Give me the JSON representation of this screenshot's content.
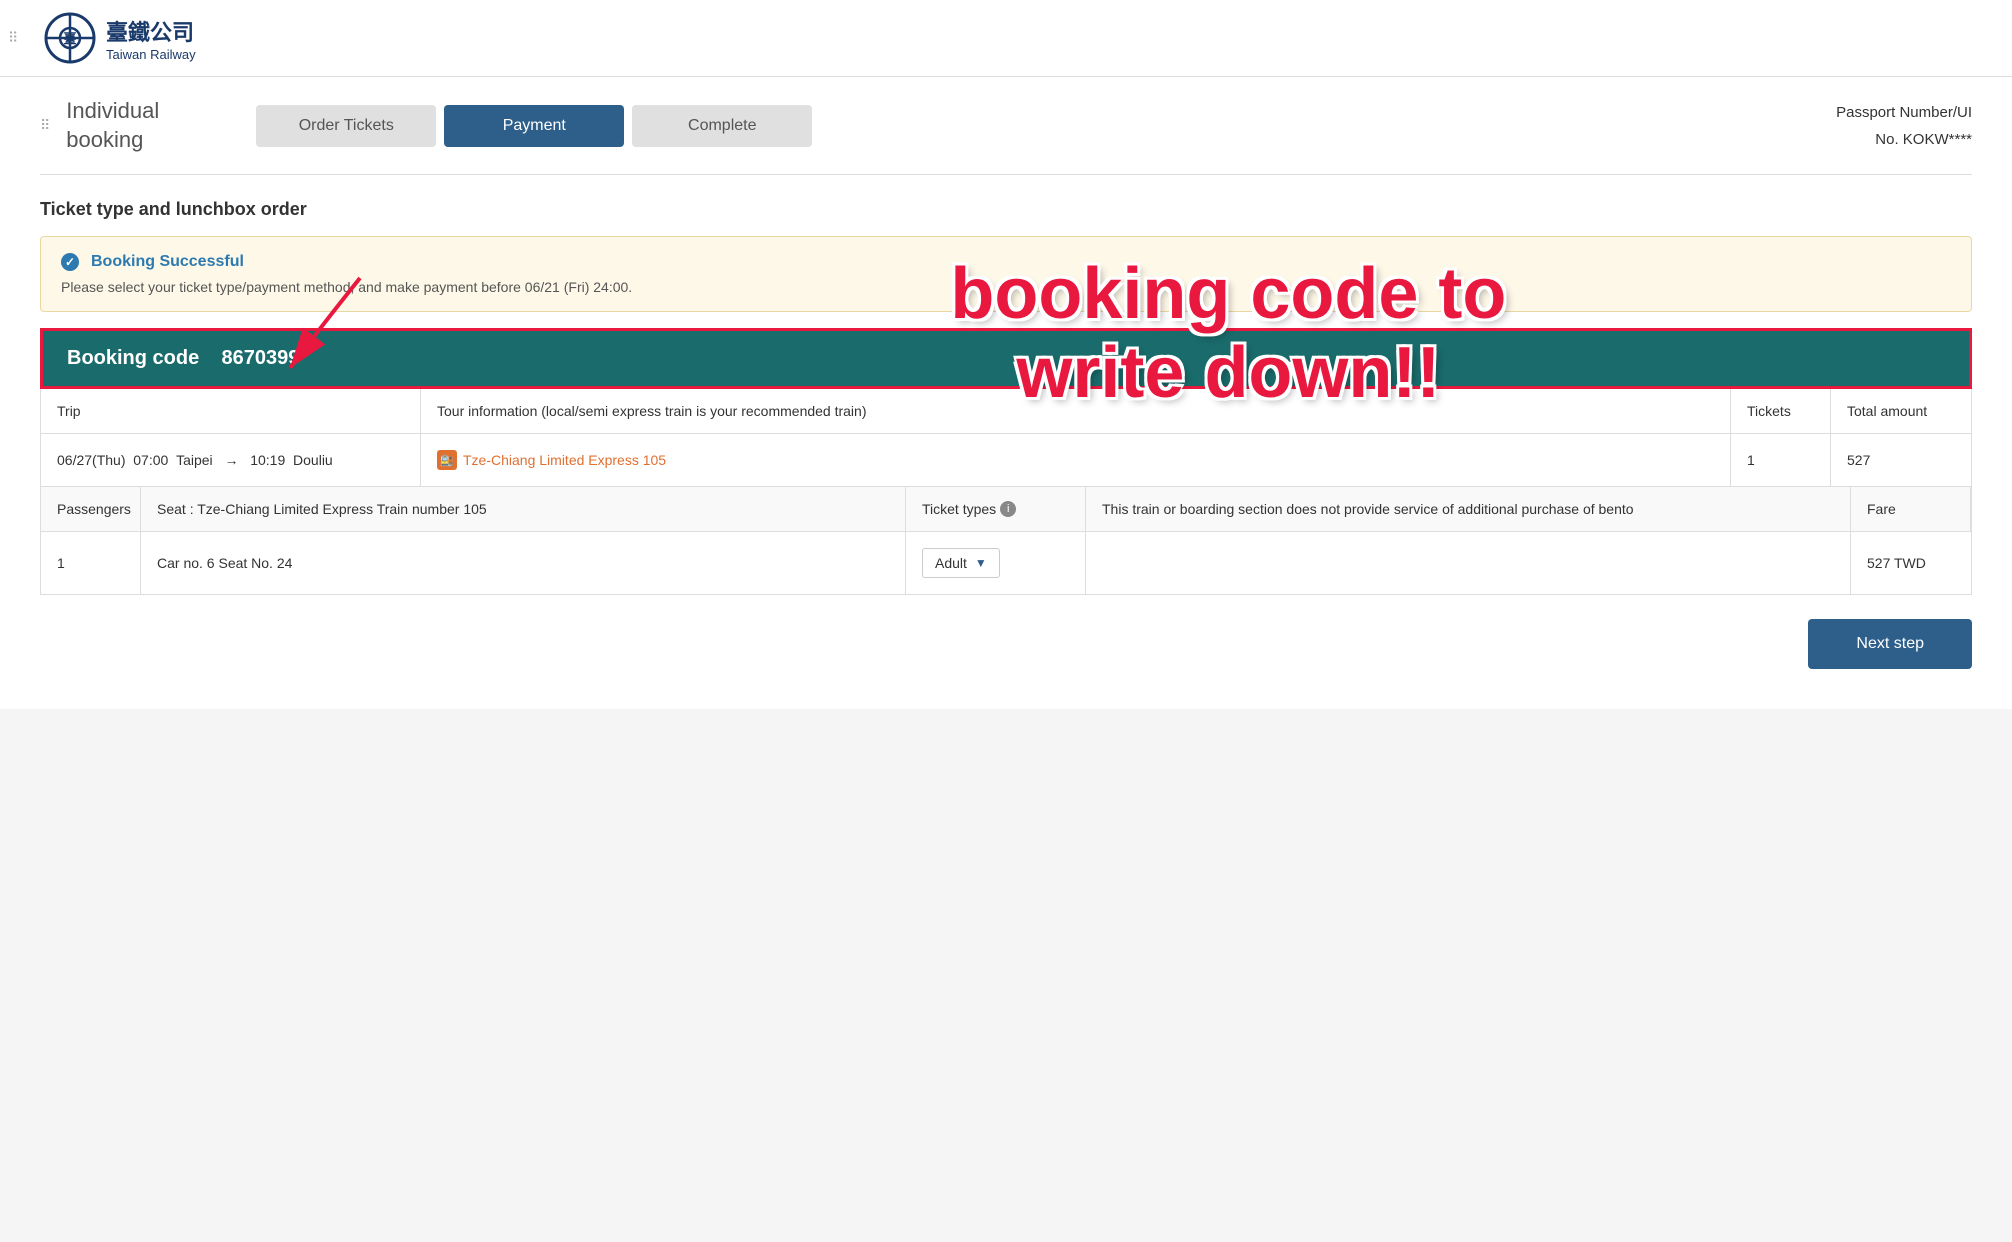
{
  "header": {
    "logo_chinese": "臺鐵公司",
    "logo_english": "Taiwan Railway"
  },
  "steps": {
    "section_title": "Individual\nbooking",
    "step1_label": "Order Tickets",
    "step2_label": "Payment",
    "step3_label": "Complete",
    "passport_label": "Passport Number/UI",
    "passport_number": "No.  KOKW****"
  },
  "section_heading": "Ticket type and lunchbox order",
  "booking_notice": {
    "success_title": "Booking Successful",
    "notice_text": "Please select your ticket type/payment method, and make payment before 06/21 (Fri) 24:00."
  },
  "booking_code": {
    "label": "Booking code",
    "value": "8670399"
  },
  "annotation": {
    "line1": "booking code to",
    "line2": "write down!!"
  },
  "table": {
    "headers": {
      "trip": "Trip",
      "tour_info": "Tour information (local/semi express train is your recommended train)",
      "tickets": "Tickets",
      "total_amount": "Total amount"
    },
    "trip_row": {
      "trip_detail": "06/27(Thu)  07:00  Taipei  →  10:19  Douliu",
      "train_name": "Tze-Chiang Limited Express 105",
      "tickets": "1",
      "total": "527"
    },
    "passenger_headers": {
      "passengers": "Passengers",
      "seat": "Seat : Tze-Chiang Limited Express Train number 105",
      "ticket_types": "Ticket types",
      "bento_note": "This train or boarding section does not provide service of additional purchase of bento",
      "fare": "Fare"
    },
    "passenger_row": {
      "number": "1",
      "seat": "Car no. 6 Seat No. 24",
      "ticket_type": "Adult",
      "bento": "",
      "fare": "527 TWD"
    }
  },
  "next_step_label": "Next step"
}
